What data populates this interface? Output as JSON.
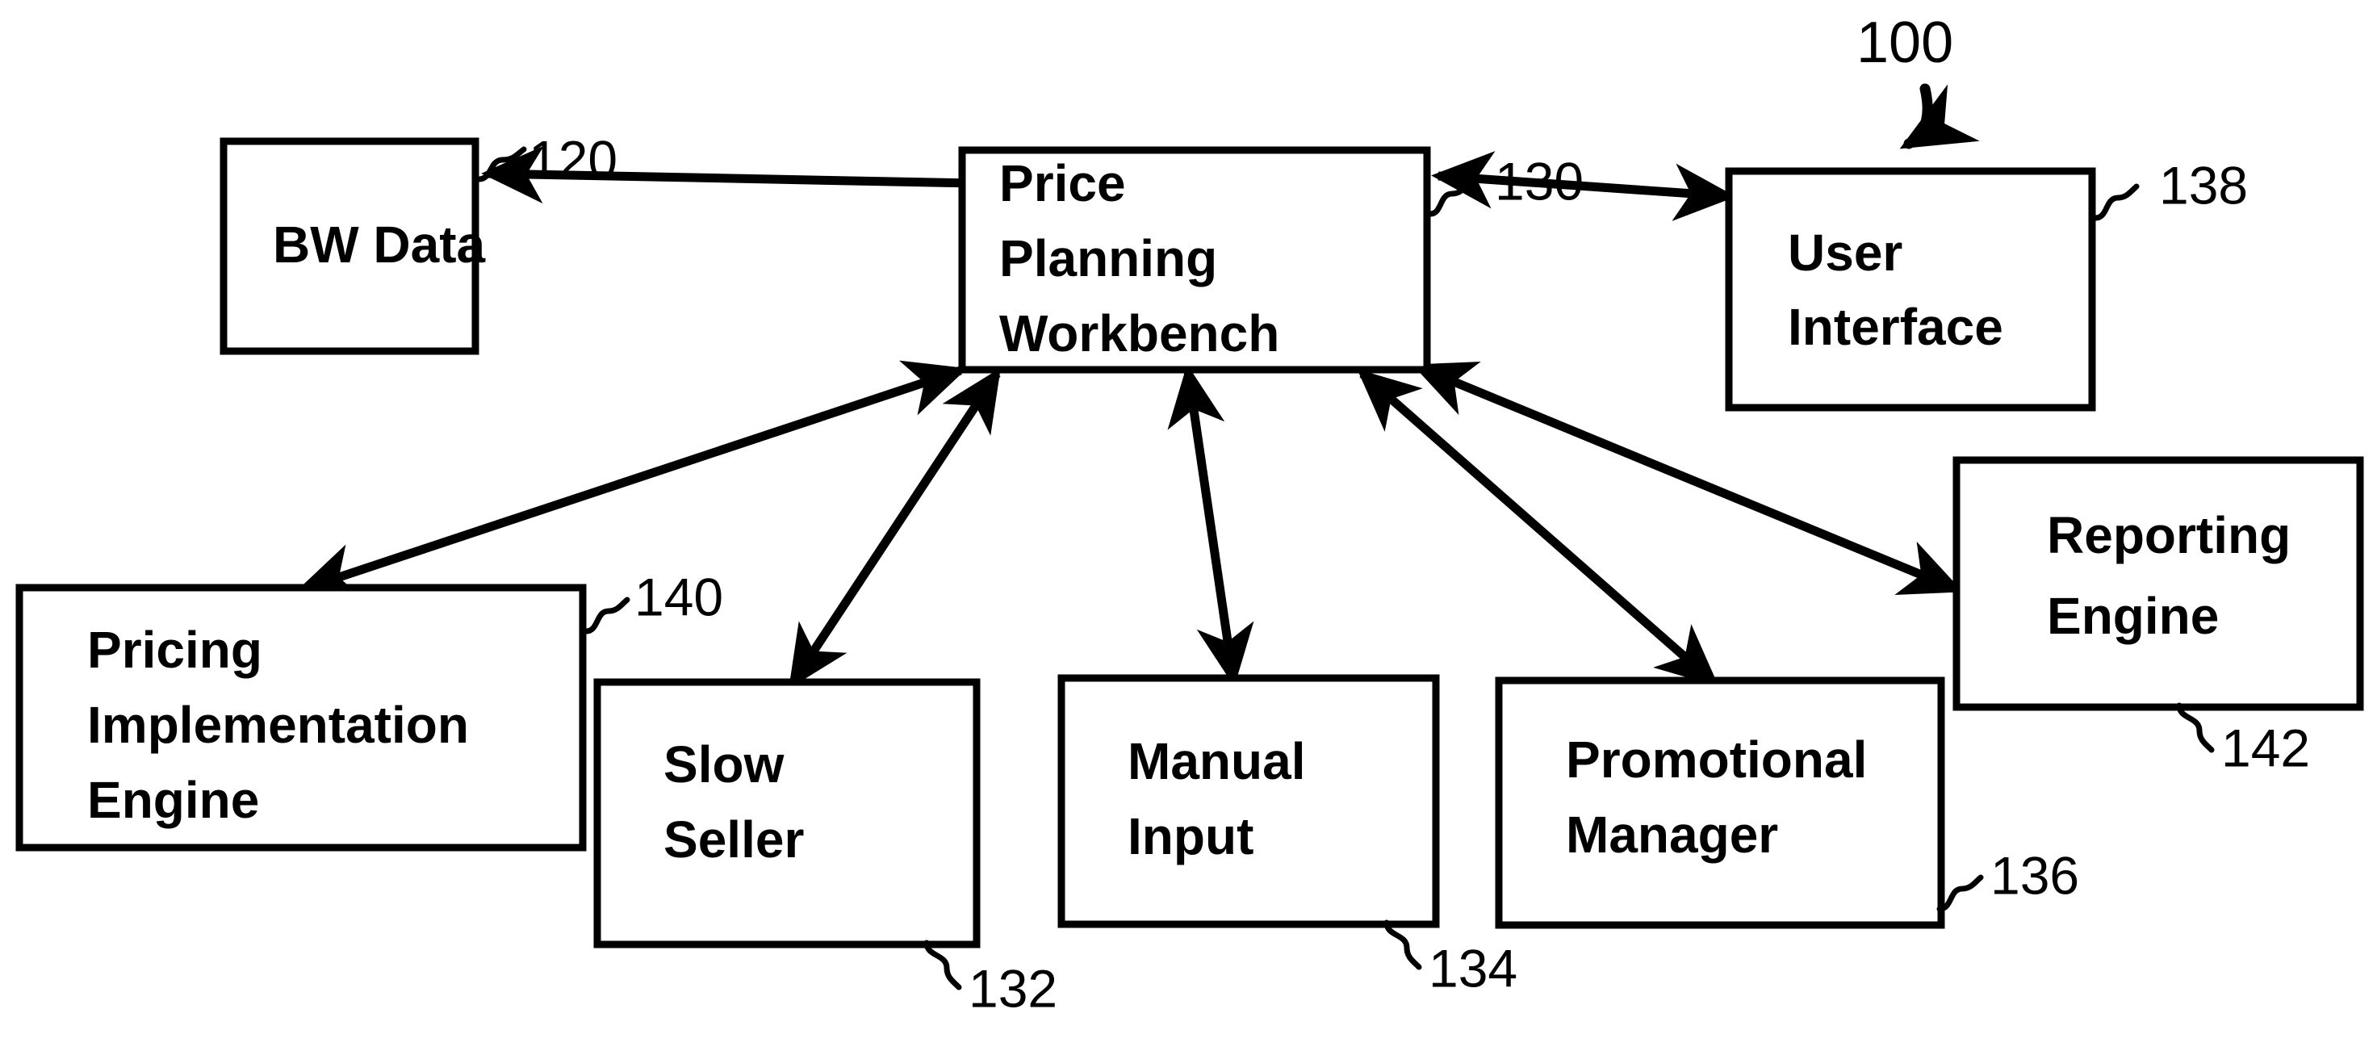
{
  "figure": {
    "type": "patent-block-diagram",
    "background_color": "#ffffff",
    "line_color": "#000000",
    "system_reference": "100"
  },
  "nodes": {
    "bw_data": {
      "label_line1": "BW Data",
      "reference": "120"
    },
    "price_planning_workbench": {
      "label_line1": "Price",
      "label_line2": "Planning",
      "label_line3": "Workbench",
      "reference": "130"
    },
    "user_interface": {
      "label_line1": "User",
      "label_line2": "Interface",
      "reference": "138"
    },
    "pricing_implementation_engine": {
      "label_line1": "Pricing",
      "label_line2": "Implementation",
      "label_line3": "Engine",
      "reference": "140"
    },
    "slow_seller": {
      "label_line1": "Slow",
      "label_line2": "Seller",
      "reference": "132"
    },
    "manual_input": {
      "label_line1": "Manual",
      "label_line2": "Input",
      "reference": "134"
    },
    "promotional_manager": {
      "label_line1": "Promotional",
      "label_line2": "Manager",
      "reference": "136"
    },
    "reporting_engine": {
      "label_line1": "Reporting",
      "label_line2": "Engine",
      "reference": "142"
    }
  },
  "connections": [
    {
      "from": "price_planning_workbench",
      "to": "bw_data",
      "style": "bidirectional"
    },
    {
      "from": "price_planning_workbench",
      "to": "user_interface",
      "style": "bidirectional"
    },
    {
      "from": "price_planning_workbench",
      "to": "pricing_implementation_engine",
      "style": "bidirectional"
    },
    {
      "from": "price_planning_workbench",
      "to": "slow_seller",
      "style": "bidirectional"
    },
    {
      "from": "price_planning_workbench",
      "to": "manual_input",
      "style": "bidirectional"
    },
    {
      "from": "price_planning_workbench",
      "to": "promotional_manager",
      "style": "bidirectional"
    },
    {
      "from": "price_planning_workbench",
      "to": "reporting_engine",
      "style": "bidirectional"
    }
  ]
}
